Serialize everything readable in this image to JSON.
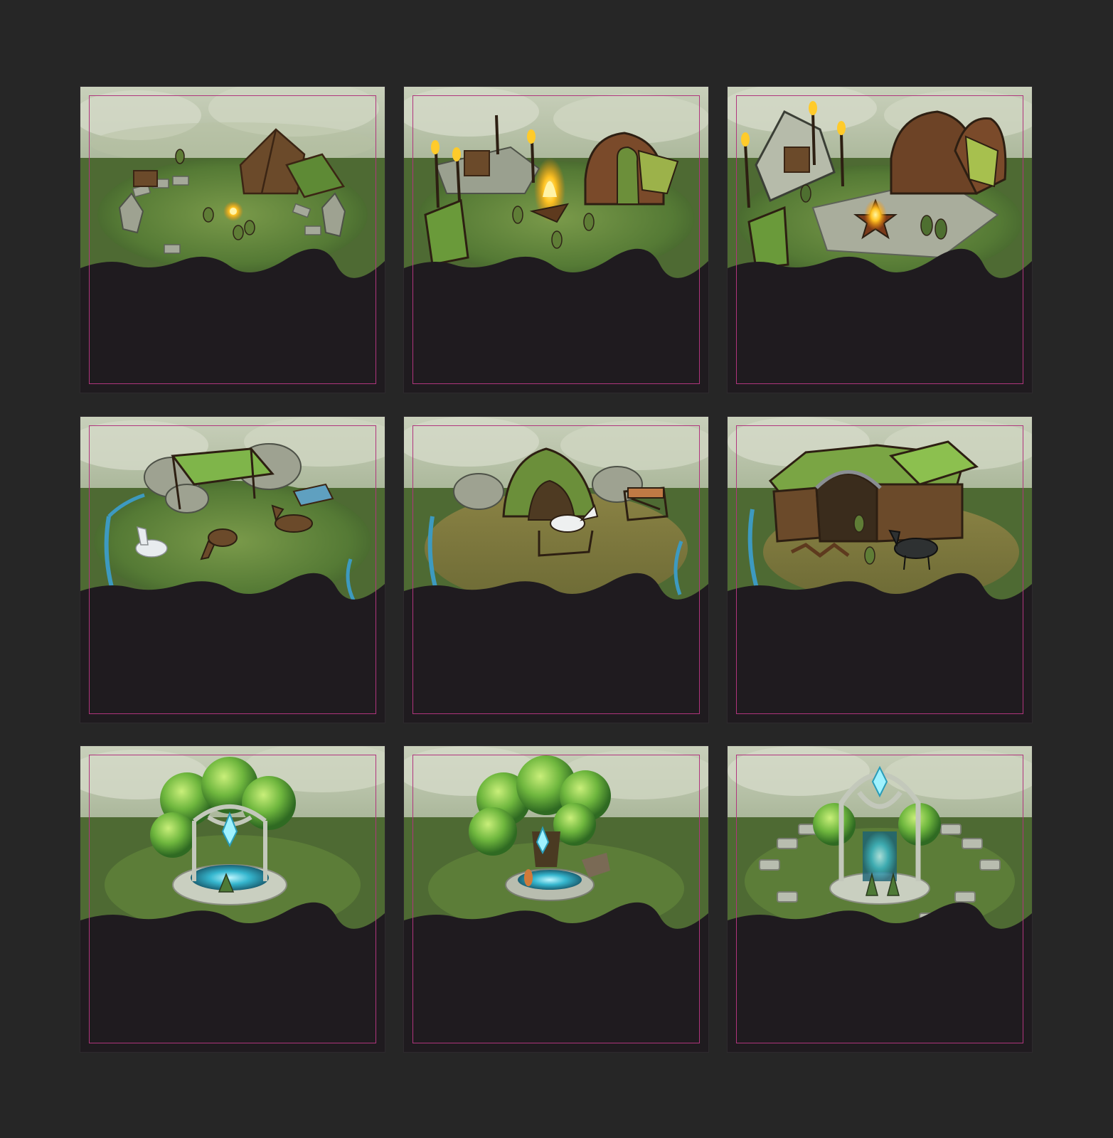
{
  "grid": {
    "rows": 3,
    "columns": 3,
    "background_color": "#262626",
    "card_color": "#1f1b1f",
    "guide_color": "#b0357d"
  },
  "cards": [
    {
      "row": 1,
      "col": 1,
      "stage": "sketch",
      "scene": "camp-with-tents-and-small-campfire"
    },
    {
      "row": 1,
      "col": 2,
      "stage": "sketch",
      "scene": "camp-with-torches-bonfire-and-hut"
    },
    {
      "row": 1,
      "col": 3,
      "stage": "sketch",
      "scene": "stone-plaza-with-star-fire-and-huts"
    },
    {
      "row": 2,
      "col": 1,
      "stage": "sketch",
      "scene": "canopy-shelter-with-horses-and-stream"
    },
    {
      "row": 2,
      "col": 2,
      "stage": "sketch",
      "scene": "arched-hut-with-horse-and-fence"
    },
    {
      "row": 2,
      "col": 3,
      "stage": "sketch",
      "scene": "stable-with-dark-horse"
    },
    {
      "row": 3,
      "col": 1,
      "stage": "painted",
      "scene": "tree-gazebo-with-crystal-fountain"
    },
    {
      "row": 3,
      "col": 2,
      "stage": "painted",
      "scene": "great-tree-with-crystal-fountain"
    },
    {
      "row": 3,
      "col": 3,
      "stage": "painted",
      "scene": "moon-arch-shrine-with-stone-ring"
    }
  ]
}
